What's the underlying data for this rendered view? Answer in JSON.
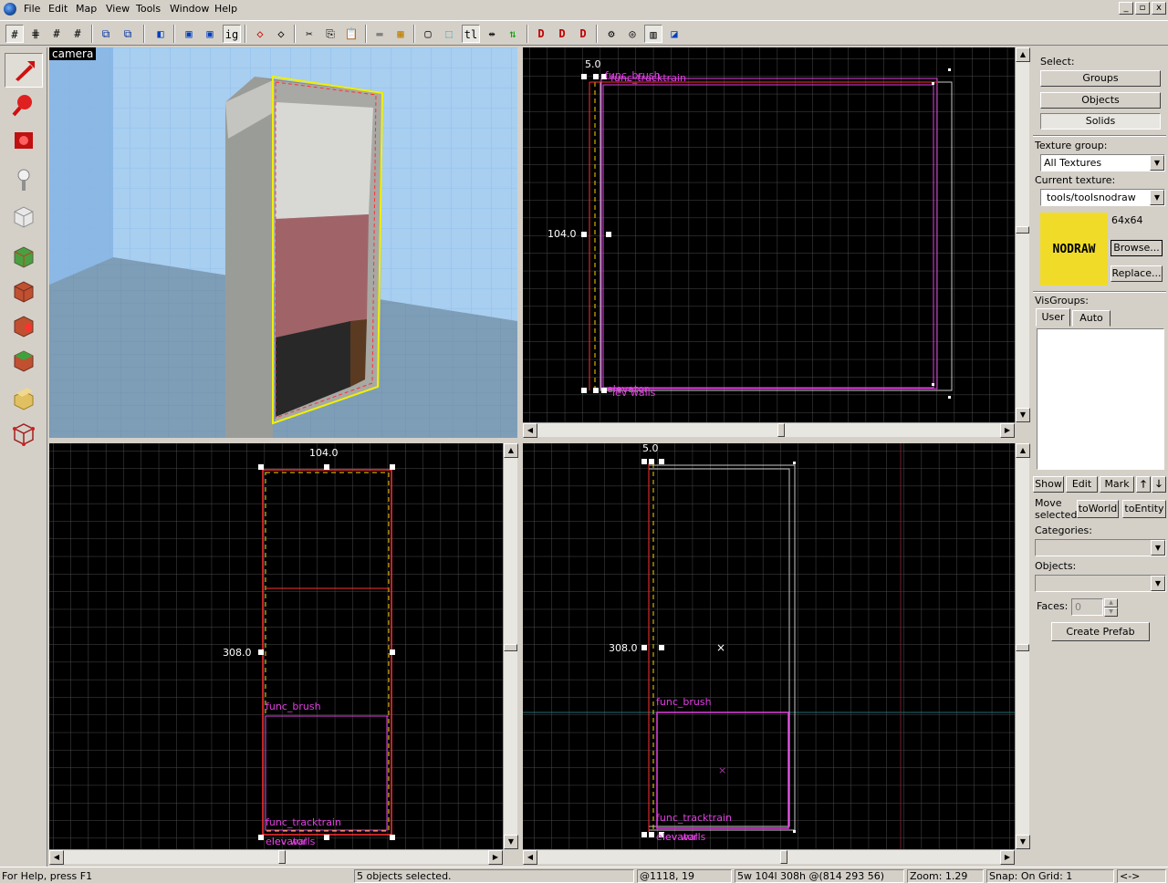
{
  "menu": {
    "items": [
      "File",
      "Edit",
      "Map",
      "View",
      "Tools",
      "Window",
      "Help"
    ],
    "window_controls": [
      "_",
      "▫",
      "x"
    ]
  },
  "toolbar": {
    "text_buttons": {
      "texture_lock_label": "ig",
      "tl_label": "tl"
    }
  },
  "viewports": {
    "camera": {
      "label": "camera"
    },
    "top": {
      "dim_width": "5.0",
      "dim_height": "104.0",
      "labels": [
        "func_brush",
        "func_tracktrain",
        "elevator",
        "lev walls"
      ]
    },
    "front": {
      "dim_width": "104.0",
      "dim_height": "308.0",
      "labels": [
        "func_brush",
        "func_tracktrain",
        "elevator",
        "lev walls"
      ]
    },
    "side": {
      "dim_width": "5.0",
      "dim_height": "308.0",
      "labels": [
        "func_brush",
        "func_tracktrain",
        "elevator",
        "lev walls"
      ]
    }
  },
  "panel": {
    "select_label": "Select:",
    "select_buttons": [
      "Groups",
      "Objects",
      "Solids"
    ],
    "texture_group_label": "Texture group:",
    "texture_group_value": "All Textures",
    "current_texture_label": "Current texture:",
    "current_texture_value": "tools/toolsnodraw",
    "texture_preview_text": "NODRAW",
    "texture_size": "64x64",
    "browse_label": "Browse...",
    "replace_label": "Replace...",
    "visgroups_label": "VisGroups:",
    "vis_tabs": [
      "User",
      "Auto"
    ],
    "vis_buttons": {
      "show": "Show",
      "edit": "Edit",
      "mark": "Mark",
      "up": "🡑",
      "down": "🡓"
    },
    "move_selected_label": "Move selected:",
    "to_world_label": "toWorld",
    "to_entity_label": "toEntity",
    "categories_label": "Categories:",
    "objects_label": "Objects:",
    "faces_label": "Faces:",
    "faces_value": "0",
    "create_prefab_label": "Create Prefab"
  },
  "status": {
    "help": "For Help, press F1",
    "selection": "5 objects selected.",
    "cursor": "@1118, 19",
    "size": "5w 104l 308h @(814 293 56)",
    "zoom": "Zoom: 1.29",
    "snap": "Snap: On Grid: 1",
    "extra": "<->"
  },
  "colors": {
    "background": "#d4d0c8",
    "viewport_bg": "#000000",
    "grid": "#4a4a4a",
    "selection": "#ff2020",
    "entity": "#e040e0",
    "highlight": "#f0f000",
    "nodraw_yellow": "#f0dc28"
  }
}
